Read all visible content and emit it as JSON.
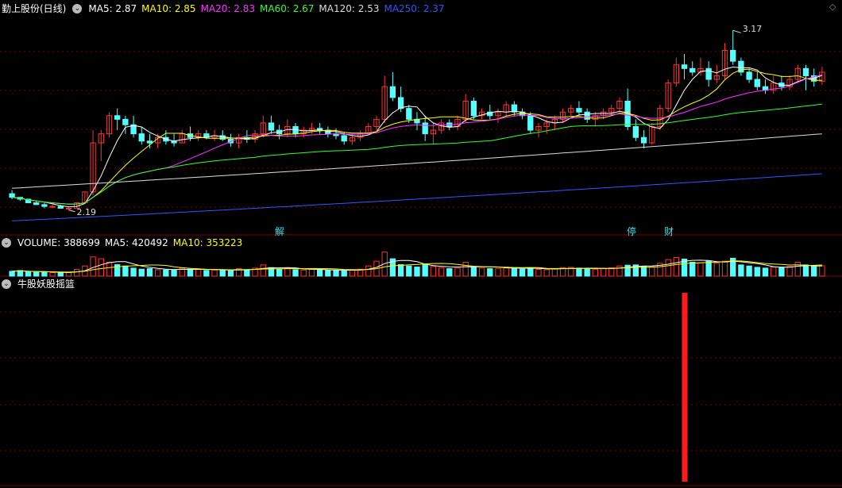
{
  "price_header": {
    "title": "勤上股份(日线)",
    "toggle": "⌄",
    "ma": [
      {
        "label": "MA5: 2.87",
        "color": "#ffffff"
      },
      {
        "label": "MA10: 2.85",
        "color": "#ffff00"
      },
      {
        "label": "MA20: 2.83",
        "color": "#ff33ff"
      },
      {
        "label": "MA60: 2.67",
        "color": "#33ff33"
      },
      {
        "label": "MA120: 2.53",
        "color": "#dddddd"
      },
      {
        "label": "MA250: 2.37",
        "color": "#3355ff"
      }
    ]
  },
  "price_chart": {
    "high_label": "3.17",
    "low_label": "2.19",
    "markers": [
      "解",
      "停",
      "财"
    ]
  },
  "volume_header": {
    "toggle": "⌄",
    "volume": {
      "label": "VOLUME: 388699",
      "color": "#ffffff"
    },
    "ma5": {
      "label": "MA5: 420492",
      "color": "#ffffff"
    },
    "ma10": {
      "label": "MA10: 353223",
      "color": "#ffff00"
    }
  },
  "indicator_header": {
    "toggle": "⌄",
    "title": "牛股妖股摇篮"
  },
  "colors": {
    "up": "#ff3333",
    "down": "#54ffff",
    "grid": "#7a0000",
    "signal": "#ff1a1a"
  },
  "chart_data": {
    "type": "candlestick",
    "candles": [
      [
        2.27,
        2.29,
        2.24,
        2.25
      ],
      [
        2.25,
        2.25,
        2.23,
        2.24
      ],
      [
        2.24,
        2.24,
        2.22,
        2.22
      ],
      [
        2.22,
        2.23,
        2.21,
        2.21
      ],
      [
        2.21,
        2.22,
        2.19,
        2.2
      ],
      [
        2.2,
        2.21,
        2.19,
        2.2
      ],
      [
        2.2,
        2.21,
        2.19,
        2.19
      ],
      [
        2.19,
        2.2,
        2.18,
        2.19
      ],
      [
        2.19,
        2.22,
        2.19,
        2.22
      ],
      [
        2.22,
        2.28,
        2.22,
        2.28
      ],
      [
        2.28,
        2.62,
        2.26,
        2.55
      ],
      [
        2.55,
        2.62,
        2.45,
        2.6
      ],
      [
        2.6,
        2.72,
        2.58,
        2.7
      ],
      [
        2.7,
        2.74,
        2.62,
        2.68
      ],
      [
        2.68,
        2.7,
        2.6,
        2.65
      ],
      [
        2.65,
        2.7,
        2.58,
        2.6
      ],
      [
        2.6,
        2.64,
        2.54,
        2.56
      ],
      [
        2.56,
        2.6,
        2.52,
        2.55
      ],
      [
        2.55,
        2.6,
        2.52,
        2.58
      ],
      [
        2.58,
        2.62,
        2.54,
        2.56
      ],
      [
        2.56,
        2.6,
        2.53,
        2.55
      ],
      [
        2.55,
        2.62,
        2.55,
        2.6
      ],
      [
        2.6,
        2.64,
        2.56,
        2.58
      ],
      [
        2.58,
        2.62,
        2.56,
        2.6
      ],
      [
        2.6,
        2.62,
        2.57,
        2.58
      ],
      [
        2.58,
        2.62,
        2.56,
        2.59
      ],
      [
        2.59,
        2.62,
        2.56,
        2.57
      ],
      [
        2.57,
        2.6,
        2.53,
        2.55
      ],
      [
        2.55,
        2.6,
        2.52,
        2.58
      ],
      [
        2.58,
        2.62,
        2.55,
        2.57
      ],
      [
        2.57,
        2.62,
        2.55,
        2.6
      ],
      [
        2.6,
        2.7,
        2.58,
        2.66
      ],
      [
        2.66,
        2.7,
        2.6,
        2.62
      ],
      [
        2.62,
        2.65,
        2.57,
        2.6
      ],
      [
        2.6,
        2.68,
        2.58,
        2.64
      ],
      [
        2.64,
        2.66,
        2.58,
        2.6
      ],
      [
        2.6,
        2.64,
        2.58,
        2.62
      ],
      [
        2.62,
        2.66,
        2.6,
        2.63
      ],
      [
        2.63,
        2.66,
        2.6,
        2.62
      ],
      [
        2.62,
        2.64,
        2.58,
        2.6
      ],
      [
        2.6,
        2.63,
        2.57,
        2.59
      ],
      [
        2.59,
        2.61,
        2.54,
        2.56
      ],
      [
        2.56,
        2.6,
        2.54,
        2.58
      ],
      [
        2.58,
        2.62,
        2.56,
        2.6
      ],
      [
        2.6,
        2.66,
        2.6,
        2.64
      ],
      [
        2.64,
        2.7,
        2.62,
        2.68
      ],
      [
        2.68,
        2.92,
        2.66,
        2.86
      ],
      [
        2.86,
        2.94,
        2.78,
        2.8
      ],
      [
        2.8,
        2.86,
        2.72,
        2.74
      ],
      [
        2.74,
        2.76,
        2.66,
        2.68
      ],
      [
        2.68,
        2.72,
        2.62,
        2.66
      ],
      [
        2.66,
        2.7,
        2.56,
        2.6
      ],
      [
        2.6,
        2.66,
        2.54,
        2.62
      ],
      [
        2.62,
        2.68,
        2.6,
        2.66
      ],
      [
        2.66,
        2.68,
        2.62,
        2.64
      ],
      [
        2.64,
        2.7,
        2.62,
        2.68
      ],
      [
        2.68,
        2.82,
        2.66,
        2.78
      ],
      [
        2.78,
        2.8,
        2.68,
        2.7
      ],
      [
        2.7,
        2.74,
        2.68,
        2.72
      ],
      [
        2.72,
        2.76,
        2.68,
        2.7
      ],
      [
        2.7,
        2.74,
        2.66,
        2.72
      ],
      [
        2.72,
        2.78,
        2.7,
        2.76
      ],
      [
        2.76,
        2.78,
        2.7,
        2.72
      ],
      [
        2.72,
        2.74,
        2.68,
        2.7
      ],
      [
        2.7,
        2.72,
        2.6,
        2.62
      ],
      [
        2.62,
        2.66,
        2.58,
        2.64
      ],
      [
        2.64,
        2.68,
        2.6,
        2.66
      ],
      [
        2.66,
        2.7,
        2.62,
        2.68
      ],
      [
        2.68,
        2.74,
        2.66,
        2.72
      ],
      [
        2.72,
        2.76,
        2.7,
        2.74
      ],
      [
        2.74,
        2.78,
        2.7,
        2.72
      ],
      [
        2.72,
        2.74,
        2.66,
        2.68
      ],
      [
        2.68,
        2.72,
        2.64,
        2.7
      ],
      [
        2.7,
        2.74,
        2.68,
        2.72
      ],
      [
        2.72,
        2.76,
        2.7,
        2.74
      ],
      [
        2.74,
        2.8,
        2.72,
        2.78
      ],
      [
        2.78,
        2.85,
        2.62,
        2.64
      ],
      [
        2.64,
        2.68,
        2.56,
        2.58
      ],
      [
        2.58,
        2.62,
        2.52,
        2.55
      ],
      [
        2.55,
        2.66,
        2.54,
        2.64
      ],
      [
        2.64,
        2.76,
        2.62,
        2.74
      ],
      [
        2.74,
        2.9,
        2.72,
        2.88
      ],
      [
        2.88,
        3.02,
        2.86,
        2.98
      ],
      [
        2.98,
        3.04,
        2.9,
        2.96
      ],
      [
        2.96,
        3.0,
        2.92,
        2.94
      ],
      [
        2.94,
        3.02,
        2.92,
        2.96
      ],
      [
        2.96,
        3.0,
        2.86,
        2.9
      ],
      [
        2.9,
        2.98,
        2.88,
        2.92
      ],
      [
        2.92,
        3.1,
        2.9,
        3.06
      ],
      [
        3.06,
        3.17,
        2.98,
        3.0
      ],
      [
        3.0,
        3.02,
        2.92,
        2.94
      ],
      [
        2.94,
        2.96,
        2.88,
        2.9
      ],
      [
        2.9,
        2.94,
        2.84,
        2.86
      ],
      [
        2.86,
        2.9,
        2.82,
        2.84
      ],
      [
        2.84,
        2.92,
        2.82,
        2.88
      ],
      [
        2.88,
        2.92,
        2.84,
        2.86
      ],
      [
        2.86,
        2.92,
        2.84,
        2.9
      ],
      [
        2.9,
        2.98,
        2.88,
        2.96
      ],
      [
        2.96,
        2.98,
        2.84,
        2.92
      ],
      [
        2.92,
        2.96,
        2.86,
        2.89
      ],
      [
        2.89,
        2.97,
        2.87,
        2.94
      ]
    ],
    "volume": [
      180000,
      210000,
      150000,
      140000,
      160000,
      130000,
      120000,
      130000,
      250000,
      380000,
      720000,
      650000,
      520000,
      430000,
      380000,
      300000,
      260000,
      280000,
      240000,
      230000,
      220000,
      300000,
      260000,
      250000,
      210000,
      230000,
      240000,
      200000,
      280000,
      240000,
      300000,
      420000,
      320000,
      260000,
      300000,
      240000,
      230000,
      260000,
      240000,
      220000,
      210000,
      200000,
      240000,
      260000,
      380000,
      560000,
      900000,
      650000,
      430000,
      380000,
      340000,
      450000,
      360000,
      310000,
      280000,
      300000,
      520000,
      330000,
      300000,
      280000,
      290000,
      340000,
      300000,
      260000,
      310000,
      250000,
      240000,
      270000,
      320000,
      330000,
      300000,
      270000,
      260000,
      290000,
      310000,
      380000,
      410000,
      420000,
      360000,
      350000,
      480000,
      620000,
      700000,
      640000,
      520000,
      500000,
      560000,
      480000,
      560000,
      670000,
      420000,
      380000,
      330000,
      300000,
      340000,
      330000,
      360000,
      520000,
      420000,
      390000,
      388699
    ],
    "signal_index": 83,
    "y_range_price": [
      2.1,
      3.25
    ],
    "y_range_volume": [
      0,
      950000
    ]
  }
}
